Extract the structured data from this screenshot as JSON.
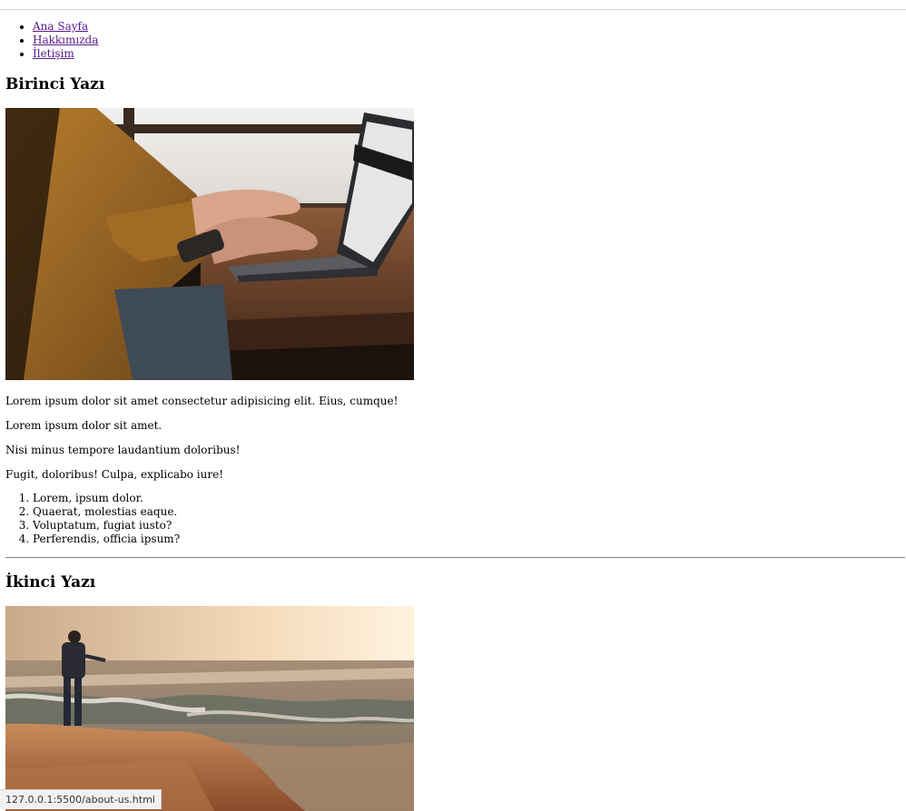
{
  "nav": {
    "items": [
      {
        "label": "Ana Sayfa"
      },
      {
        "label": "Hakkımızda"
      },
      {
        "label": "İletişim"
      }
    ]
  },
  "posts": [
    {
      "title": "Birinci Yazı",
      "image": "woman-typing-on-laptop-photo",
      "paragraphs": [
        "Lorem ipsum dolor sit amet consectetur adipisicing elit. Eius, cumque!",
        "Lorem ipsum dolor sit amet.",
        "Nisi minus tempore laudantium doloribus!",
        "Fugit, doloribus! Culpa, explicabo iure!"
      ],
      "list": [
        "Lorem, ipsum dolor.",
        "Quaerat, molestias eaque.",
        "Voluptatum, fugiat iusto?",
        "Perferendis, officia ipsum?"
      ]
    },
    {
      "title": "İkinci Yazı",
      "image": "man-standing-on-seashore-photo"
    }
  ],
  "status_bar": {
    "url": "127.0.0.1:5500/about-us.html"
  }
}
